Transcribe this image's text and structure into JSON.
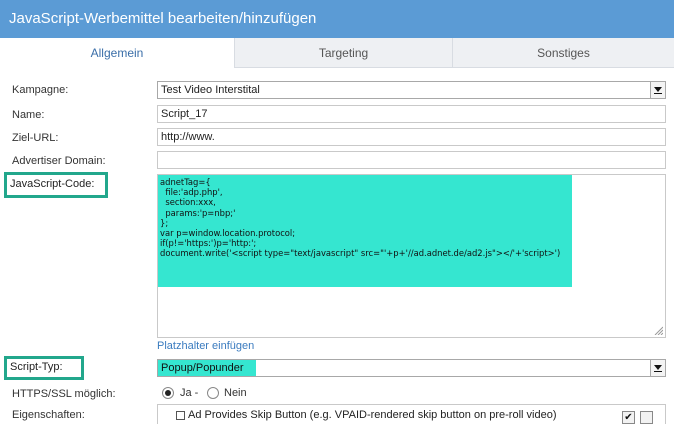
{
  "dialog": {
    "title": "JavaScript-Werbemittel bearbeiten/hinzufügen"
  },
  "tabs": [
    {
      "label": "Allgemein",
      "active": true
    },
    {
      "label": "Targeting",
      "active": false
    },
    {
      "label": "Sonstiges",
      "active": false
    }
  ],
  "form": {
    "kampagne": {
      "label": "Kampagne:",
      "value": "Test Video Interstital"
    },
    "name": {
      "label": "Name:",
      "value": "Script_17"
    },
    "ziel_url": {
      "label": "Ziel-URL:",
      "value": "http://www."
    },
    "advertiser_domain": {
      "label": "Advertiser Domain:",
      "value": ""
    },
    "javascript_code": {
      "label": "JavaScript-Code:",
      "value": "adnetTag={\n  file:'adp.php',\n  section:xxx,\n  params:'p=nbp;'\n};\nvar p=window.location.protocol;\nif(p!='https:')p='http:';\ndocument.write('<script type=\"text/javascript\" src=\"'+p+'//ad.adnet.de/ad2.js\"></'+'script>')"
    },
    "placeholder_link": "Platzhalter einfügen",
    "script_typ": {
      "label": "Script-Typ:",
      "value": "Popup/Popunder"
    },
    "https": {
      "label": "HTTPS/SSL möglich:",
      "options": [
        {
          "label": "Ja -",
          "checked": true
        },
        {
          "label": "Nein",
          "checked": false
        }
      ]
    },
    "eigenschaften": {
      "label": "Eigenschaften:",
      "item": "Ad Provides Skip Button (e.g. VPAID-rendered skip button on pre-roll video)",
      "btn_check": "✔"
    }
  },
  "colors": {
    "titlebar": "#5b9bd5",
    "highlight": "#35e6d0",
    "highlight_border": "#22a78c",
    "link": "#3a7bbf"
  }
}
